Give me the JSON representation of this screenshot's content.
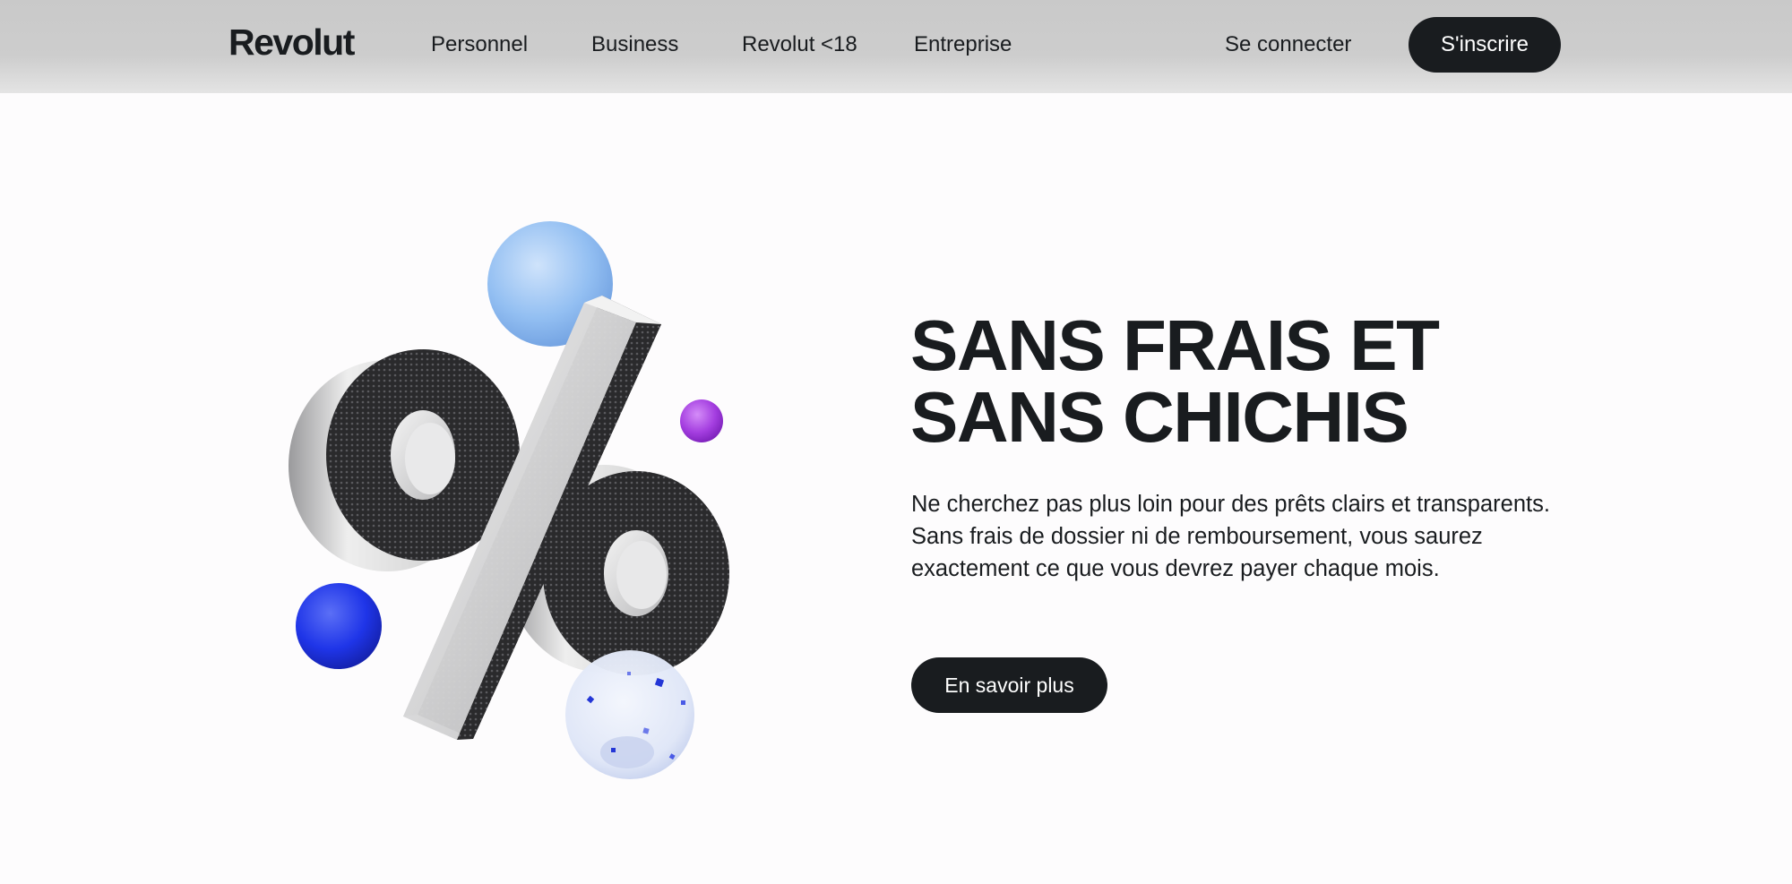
{
  "header": {
    "logo": "Revolut",
    "nav": [
      {
        "label": "Personnel"
      },
      {
        "label": "Business"
      },
      {
        "label": "Revolut <18"
      },
      {
        "label": "Entreprise"
      }
    ],
    "signin_label": "Se connecter",
    "signup_label": "S'inscrire"
  },
  "illustration": {
    "icon": "percent-3d-icon",
    "spheres": [
      "light-blue-sphere",
      "purple-sphere",
      "blue-sphere",
      "confetti-glass-sphere"
    ]
  },
  "hero": {
    "title_line1": "SANS FRAIS ET",
    "title_line2": "SANS CHICHIS",
    "description": "Ne cherchez pas plus loin pour des prêts clairs et transparents. Sans frais de dossier ni de remboursement, vous saurez exactement ce que vous devrez payer chaque mois.",
    "cta_label": "En savoir plus"
  },
  "colors": {
    "text": "#191c1f",
    "button_bg": "#191c1f",
    "button_text": "#ffffff",
    "header_bg": "#cbcbcb",
    "page_bg": "#fdfcfd",
    "accent_blue": "#1f35e8",
    "accent_light_blue": "#8fbbf0",
    "accent_purple": "#a43ee0"
  }
}
